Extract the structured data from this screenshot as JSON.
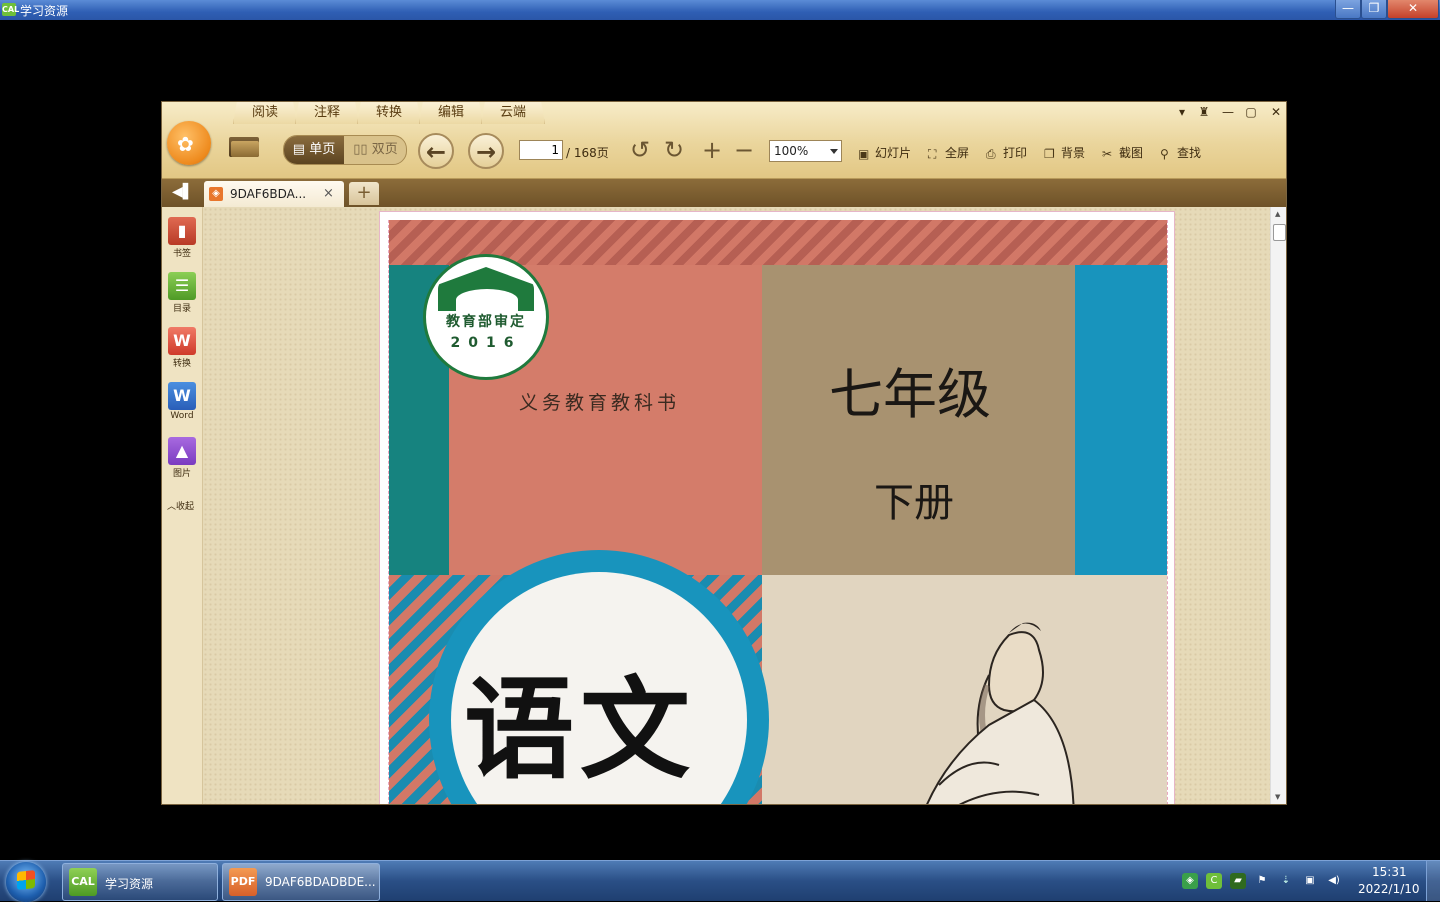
{
  "outer_window": {
    "title": "学习资源",
    "icon_text": "CAL",
    "min": "—",
    "max": "❐",
    "close": "✕"
  },
  "reader": {
    "menu_tabs": [
      "阅读",
      "注释",
      "转换",
      "编辑",
      "云端"
    ],
    "window_controls": [
      "▾",
      "♜",
      "—",
      "▢",
      "✕"
    ],
    "view_single": "单页",
    "view_double": "双页",
    "current_page": "1",
    "page_total": "/ 168页",
    "zoom": "100%",
    "tools": {
      "slideshow": "幻灯片",
      "fullscreen": "全屏",
      "print": "打印",
      "background": "背景",
      "screenshot": "截图",
      "find": "查找"
    },
    "doc_tab": "9DAF6BDA...",
    "doc_tab_close": "×",
    "new_tab": "+",
    "sidebar": {
      "bookmark": "书签",
      "toc": "目录",
      "convert": "转换",
      "word": "Word",
      "image": "图片",
      "fold": "︿收起"
    }
  },
  "cover": {
    "seal_text": "教育部审定",
    "seal_year": "2016",
    "series": "义务教育教科书",
    "grade": "七年级",
    "volume": "下册",
    "subject": "语文"
  },
  "taskbar": {
    "tasks": [
      {
        "label": "学习资源",
        "icon": "CAL"
      },
      {
        "label": "9DAF6BDADBDE...",
        "icon": "PDF"
      }
    ],
    "time": "15:31",
    "date": "2022/1/10"
  },
  "colors": {
    "toolbar_gold": "#ead59c",
    "teal": "#16837f",
    "salmon": "#d47c6a",
    "tan": "#a89270",
    "blue": "#1894bd",
    "seal_green": "#1f7a3d"
  }
}
